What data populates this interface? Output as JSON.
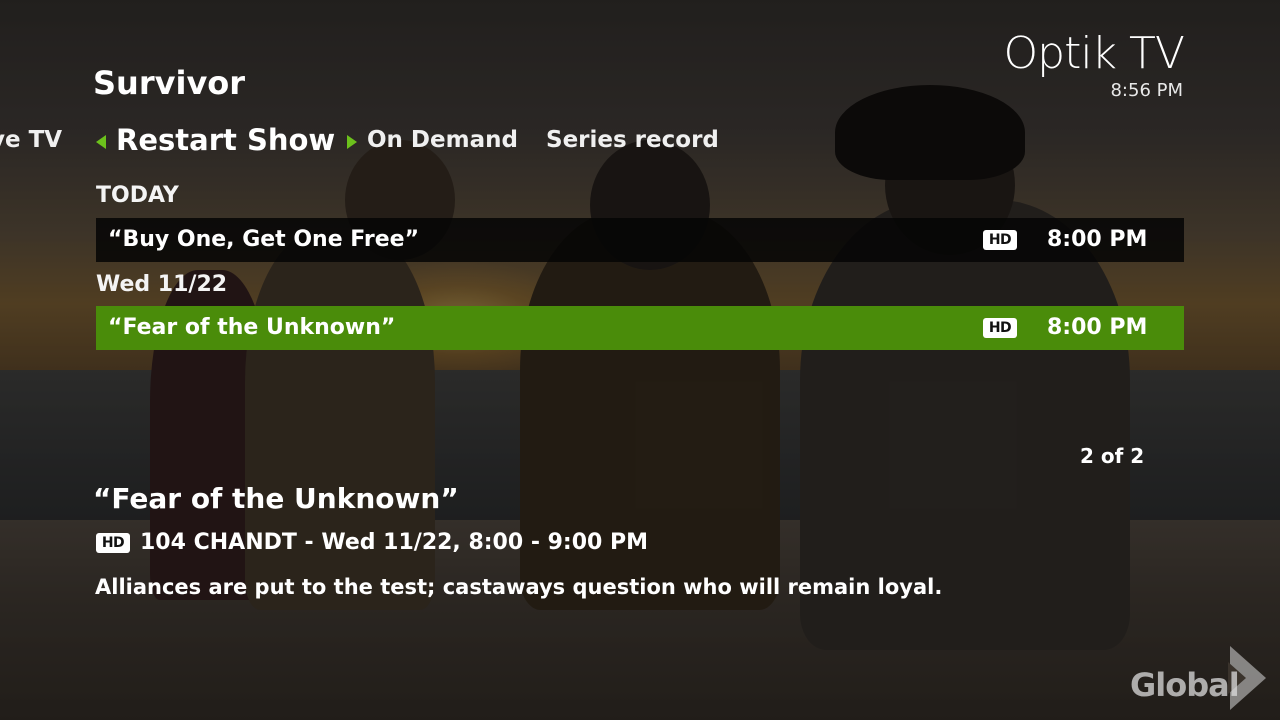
{
  "header": {
    "brand": "Optik TV",
    "time": "8:56 PM"
  },
  "show": {
    "title": "Survivor"
  },
  "tabs": {
    "previous": "ve TV",
    "active": "Restart Show",
    "items": [
      "On Demand",
      "Series record"
    ]
  },
  "listings": [
    {
      "group": "TODAY",
      "episode": "“Buy One, Get One Free”",
      "badge": "HD",
      "time": "8:00 PM",
      "selected": false
    },
    {
      "group": "Wed 11/22",
      "episode": "“Fear of the Unknown”",
      "badge": "HD",
      "time": "8:00 PM",
      "selected": true
    }
  ],
  "pager": "2 of 2",
  "detail": {
    "title": "“Fear of the Unknown”",
    "badge": "HD",
    "channel_number": "104",
    "channel_name": "CHANDT",
    "separator": "-",
    "airing": "Wed 11/22, 8:00 - 9:00 PM",
    "description": "Alliances are put to the test; castaways question who will remain loyal."
  },
  "network": {
    "logo_text": "Global",
    "icon": "chevron-right-icon"
  },
  "colors": {
    "accent_green": "#4a8c0a",
    "arrow_green": "#6cc11c",
    "row_dark": "#050505"
  }
}
